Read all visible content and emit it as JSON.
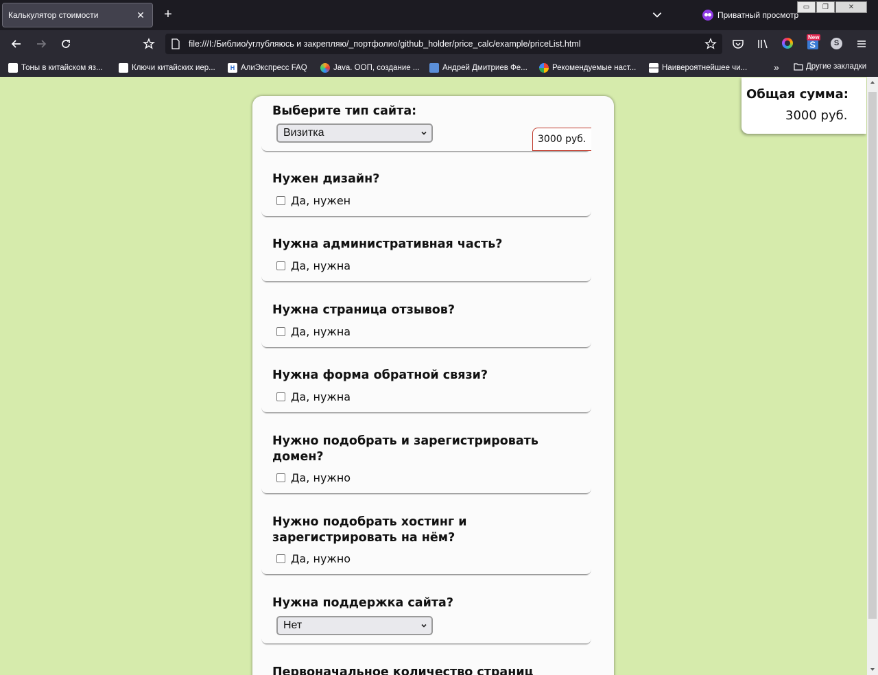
{
  "browser": {
    "tab_title": "Калькулятор стоимости",
    "new_tab_symbol": "+",
    "private_label": "Приватный просмотр",
    "url": "file:///I:/Библио/углубляюсь и закрепляю/_портфолио/github_holder/price_calc/example/priceList.html",
    "new_badge": "New",
    "sync_letter": "S",
    "window_buttons": [
      "▭",
      "❐",
      "✕"
    ],
    "bookmarks": [
      {
        "label": "Тоны в китайском яз...",
        "icon": "owl-icon",
        "color": "#ffffff"
      },
      {
        "label": "Ключи китайских иер...",
        "icon": "owl-icon",
        "color": "#ffffff"
      },
      {
        "label": "АлиЭкспресс  FAQ",
        "icon": "hy-icon",
        "color": "#ffffff"
      },
      {
        "label": "Java. ООП, создание ...",
        "icon": "joomla-icon",
        "color": "#f4a326"
      },
      {
        "label": "Андрей Дмитриев Фе...",
        "icon": "cube-icon",
        "color": "#5b8fd9"
      },
      {
        "label": "Рекомендуемые наст...",
        "icon": "google-icon",
        "color": "#ffffff"
      },
      {
        "label": "Наивероятнейшее чи...",
        "icon": "grid-icon",
        "color": "#ffffff"
      }
    ],
    "bookmarks_more": "»",
    "other_bookmarks": "Другие закладки"
  },
  "form": {
    "site_type": {
      "title": "Выберите тип сайта:",
      "selected": "Визитка",
      "price": "3000 руб."
    },
    "design": {
      "title": "Нужен дизайн?",
      "option": "Да, нужен"
    },
    "admin": {
      "title": "Нужна административная часть?",
      "option": "Да, нужна"
    },
    "reviews": {
      "title": "Нужна страница отзывов?",
      "option": "Да, нужна"
    },
    "feedback": {
      "title": "Нужна форма обратной связи?",
      "option": "Да, нужна"
    },
    "domain": {
      "title": "Нужно подобрать и зарегистрировать домен?",
      "option": "Да, нужно"
    },
    "hosting": {
      "title": "Нужно подобрать хостинг и зарегистрировать на нём?",
      "option": "Да, нужно"
    },
    "support": {
      "title": "Нужна поддержка сайта?",
      "selected": "Нет"
    },
    "pages": {
      "title": "Первоначальное количество страниц"
    }
  },
  "total": {
    "label": "Общая сумма:",
    "value": "3000 руб."
  },
  "colors": {
    "page_background": "#d6ebac",
    "card_background": "#fbfbfb",
    "price_border": "#c0392b",
    "chrome_dark": "#1c1b22"
  }
}
